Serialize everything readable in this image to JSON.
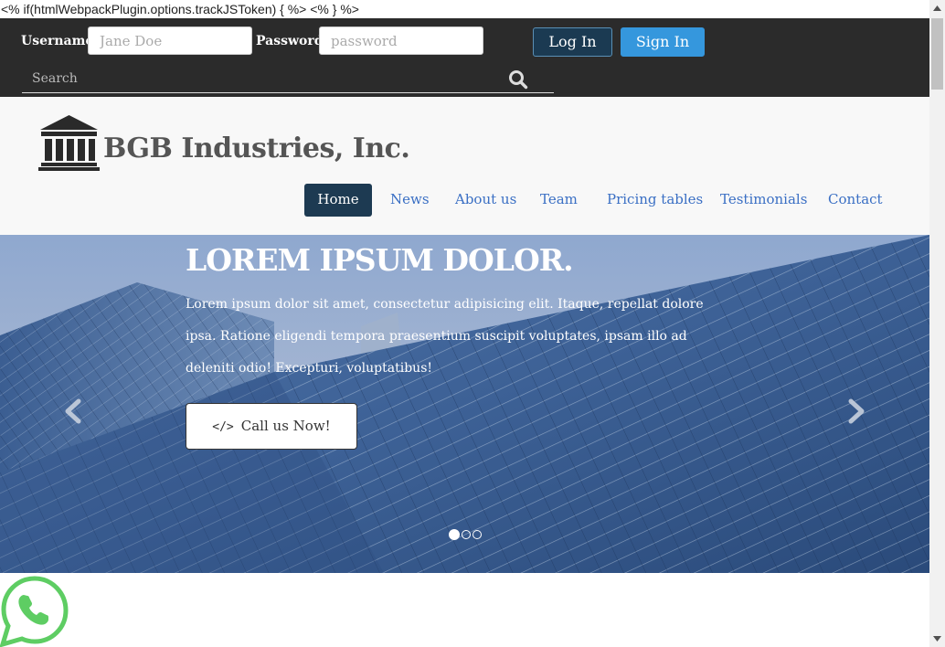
{
  "template_line": "<% if(htmlWebpackPlugin.options.trackJSToken) { %> <% } %>",
  "topbar": {
    "username_label": "Username:",
    "username_placeholder": "Jane Doe",
    "password_label": "Password:",
    "password_placeholder": "password",
    "login_label": "Log In",
    "signin_label": "Sign In",
    "search_placeholder": "Search",
    "search_icon": "search-icon"
  },
  "header": {
    "brand": "BGB Industries, Inc.",
    "logo_icon": "bank-building-icon",
    "nav": [
      {
        "label": "Home",
        "active": true
      },
      {
        "label": "News"
      },
      {
        "label": "About us"
      },
      {
        "label": "Team"
      },
      {
        "label": "Pricing tables"
      },
      {
        "label": "Testimonials"
      },
      {
        "label": "Contact"
      }
    ]
  },
  "hero": {
    "title": "LOREM IPSUM DOLOR.",
    "text": "Lorem ipsum dolor sit amet, consectetur adipisicing elit. Itaque, repellat dolore ipsa. Ratione eligendi tempora praesentium suscipit voluptates, ipsam illo ad deleniti odio! Excepturi, voluptatibus!",
    "cta_icon": "</>",
    "cta_label": "Call us Now!",
    "slide_count": 3,
    "active_slide": 1
  },
  "colors": {
    "topbar_bg": "#2b2b2b",
    "nav_active_bg": "#1d3a52",
    "nav_link": "#3a6fc4",
    "signin_bg": "#3597dd",
    "whatsapp_green": "#5ecd63"
  }
}
